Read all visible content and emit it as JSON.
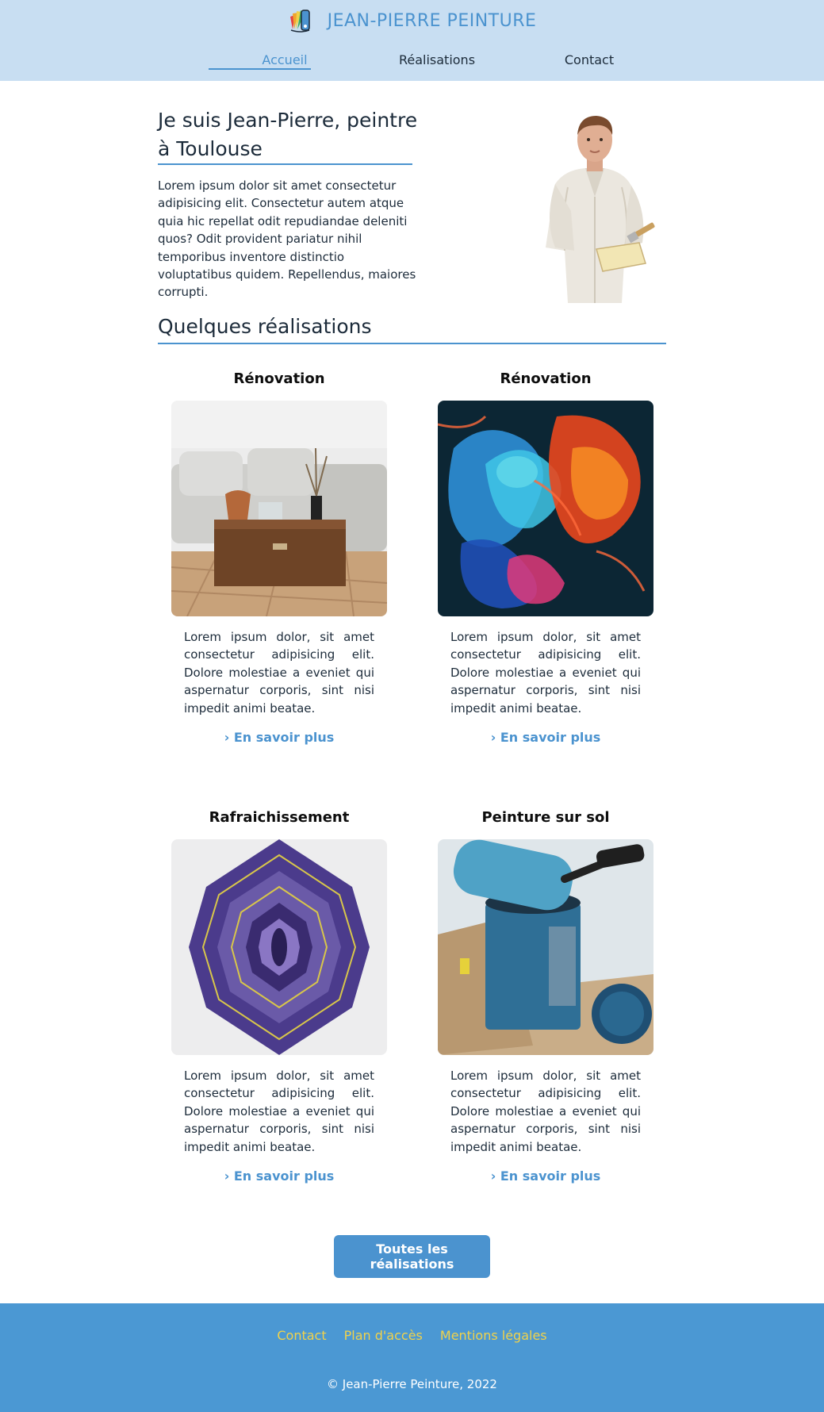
{
  "brand": {
    "name": "JEAN-PIERRE PEINTURE",
    "logo_icon": "paint-swatch-icon"
  },
  "nav": {
    "items": [
      {
        "label": "Accueil",
        "active": true
      },
      {
        "label": "Réalisations",
        "active": false
      },
      {
        "label": "Contact",
        "active": false
      }
    ]
  },
  "intro": {
    "title": "Je suis Jean-Pierre, peintre à Toulouse",
    "text": "Lorem ipsum dolor sit amet consectetur adipisicing elit. Consectetur autem atque quia hic repellat odit repudiandae deleniti quos? Odit provident pariatur nihil temporibus inventore distinctio voluptatibus quidem. Repellendus, maiores corrupti."
  },
  "section": {
    "title": "Quelques réalisations"
  },
  "cards": [
    {
      "title": "Rénovation",
      "image": "living-room-photo",
      "text": "Lorem ipsum dolor, sit amet consectetur adipisicing elit. Dolore molestiae a eveniet qui aspernatur corporis, sint nisi impedit animi beatae.",
      "link": "› En savoir plus"
    },
    {
      "title": "Rénovation",
      "image": "colored-ink-smoke-photo",
      "text": "Lorem ipsum dolor, sit amet consectetur adipisicing elit. Dolore molestiae a eveniet qui aspernatur corporis, sint nisi impedit animi beatae.",
      "link": "› En savoir plus"
    },
    {
      "title": "Rafraichissement",
      "image": "purple-paint-pattern-photo",
      "text": "Lorem ipsum dolor, sit amet consectetur adipisicing elit. Dolore molestiae a eveniet qui aspernatur corporis, sint nisi impedit animi beatae.",
      "link": "› En savoir plus"
    },
    {
      "title": "Peinture sur sol",
      "image": "paint-roller-can-photo",
      "text": "Lorem ipsum dolor, sit amet consectetur adipisicing elit. Dolore molestiae a eveniet qui aspernatur corporis, sint nisi impedit animi beatae.",
      "link": "› En savoir plus"
    }
  ],
  "all_button": "Toutes les réalisations",
  "footer": {
    "links": [
      "Contact",
      "Plan d'accès",
      "Mentions légales"
    ],
    "copyright": "© Jean-Pierre Peinture, 2022"
  },
  "colors": {
    "header_bg": "#c8def2",
    "accent": "#4b93cf",
    "footer_bg": "#4b98d3",
    "footer_link": "#f1d24a"
  }
}
